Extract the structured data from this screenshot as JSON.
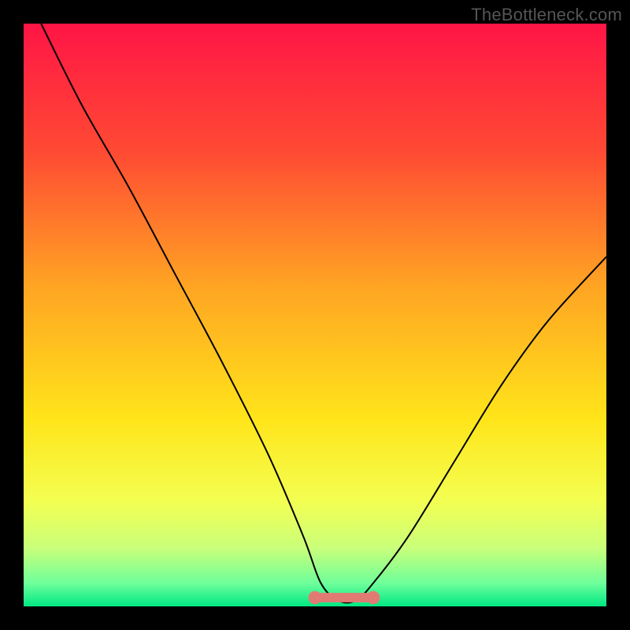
{
  "watermark": "TheBottleneck.com",
  "chart_data": {
    "type": "line",
    "title": "",
    "xlabel": "",
    "ylabel": "",
    "xlim": [
      0,
      100
    ],
    "ylim": [
      0,
      100
    ],
    "gradient_stops": [
      {
        "offset": 0.0,
        "color": "#ff1546"
      },
      {
        "offset": 0.22,
        "color": "#ff4a33"
      },
      {
        "offset": 0.45,
        "color": "#ffa423"
      },
      {
        "offset": 0.68,
        "color": "#ffe51a"
      },
      {
        "offset": 0.82,
        "color": "#f3ff52"
      },
      {
        "offset": 0.9,
        "color": "#c9ff7a"
      },
      {
        "offset": 0.96,
        "color": "#6fff9a"
      },
      {
        "offset": 1.0,
        "color": "#00e884"
      }
    ],
    "series": [
      {
        "name": "curve",
        "x": [
          3,
          10,
          18,
          26,
          34,
          42,
          48,
          51,
          54,
          57,
          60,
          66,
          74,
          82,
          90,
          100
        ],
        "y": [
          100,
          86,
          72,
          57,
          42,
          26,
          12,
          4,
          1,
          1,
          4,
          12,
          25,
          38,
          49,
          60
        ]
      }
    ],
    "flat_segment": {
      "x_start": 50,
      "x_end": 60,
      "y": 1.5,
      "color": "#e27a74",
      "stroke_width": 12
    },
    "curve_color": "#000000",
    "curve_width": 2
  }
}
